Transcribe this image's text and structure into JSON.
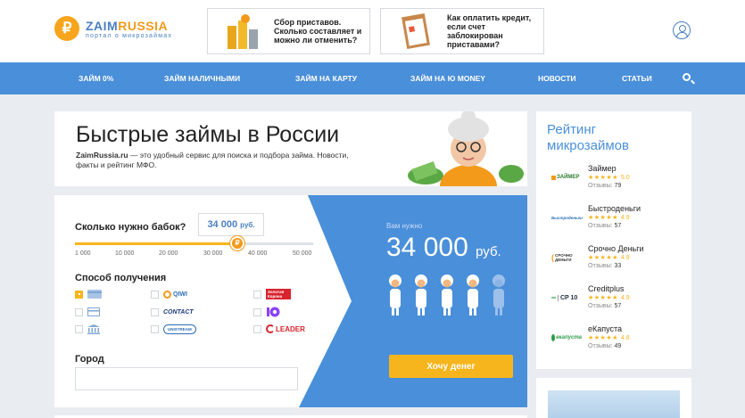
{
  "brand": {
    "name_a": "ZAIM",
    "name_b": "RUSSIA",
    "tagline": "портал о микрозаймах",
    "symbol": "₽"
  },
  "promos": [
    {
      "text": "Сбор приставов. Сколько составляет и можно ли отменить?"
    },
    {
      "text": "Как оплатить кредит, если счет заблокирован приставами?"
    }
  ],
  "nav": [
    {
      "label": "Займ 0%"
    },
    {
      "label": "Займ наличными"
    },
    {
      "label": "Займ на карту"
    },
    {
      "label": "Займ на Ю Money"
    },
    {
      "label": "Новости"
    },
    {
      "label": "Статьи"
    }
  ],
  "hero": {
    "title": "Быстрые займы в России",
    "site": "ZaimRussia.ru",
    "desc": " — это удобный сервис для поиска и подбора займа. Новости, факты и рейтинг МФО."
  },
  "calc": {
    "question": "Сколько нужно бабок?",
    "amount_value": "34 000",
    "amount_unit": "руб.",
    "slider_fraction": 0.68,
    "ticks": [
      "1 000",
      "10 000",
      "20 000",
      "30 000",
      "40 000",
      "50 000"
    ],
    "method_title": "Способ получения",
    "methods": [
      {
        "name": "card",
        "label": "",
        "checked": true
      },
      {
        "name": "qiwi",
        "label": "QIWI",
        "checked": false
      },
      {
        "name": "zolotaya-korona",
        "label": "Золотая Корона",
        "checked": false
      },
      {
        "name": "bank",
        "label": "",
        "checked": false
      },
      {
        "name": "contact",
        "label": "CONTACT",
        "checked": false
      },
      {
        "name": "yoomoney",
        "label": "",
        "checked": false
      },
      {
        "name": "bank-building",
        "label": "",
        "checked": false
      },
      {
        "name": "unistream",
        "label": "UNISTREAM",
        "checked": false
      },
      {
        "name": "leader",
        "label": "LEADER",
        "checked": false
      }
    ],
    "city_label": "Город",
    "city_value": "",
    "need_label": "Вам нужно",
    "need_amount": "34 000",
    "need_unit": "руб.",
    "grannies_filled": 4,
    "grannies_total": 5,
    "cta": "Хочу денег"
  },
  "rating": {
    "title": "Рейтинг микрозаймов",
    "reviews_label": "Отзывы: ",
    "items": [
      {
        "name": "Займер",
        "score": "5.0",
        "reviews": "79",
        "logo": "ЗАЙМЕР"
      },
      {
        "name": "Быстроденьги",
        "score": "4.9",
        "reviews": "57",
        "logo": "Быстроденьги"
      },
      {
        "name": "Срочно Деньги",
        "score": "4.9",
        "reviews": "33",
        "logo": "СРОЧНО ДЕНЬГИ"
      },
      {
        "name": "Creditplus",
        "score": "4.9",
        "reviews": "57",
        "logo": "CP 10"
      },
      {
        "name": "еКапуста",
        "score": "4.8",
        "reviews": "49",
        "logo": "екапуста"
      }
    ]
  },
  "colors": {
    "brand_blue": "#4a8fd9",
    "accent_orange": "#f7b51d",
    "panel_blue": "#4a8fd9"
  },
  "icons": {
    "search": "search-icon",
    "user": "user-icon"
  }
}
